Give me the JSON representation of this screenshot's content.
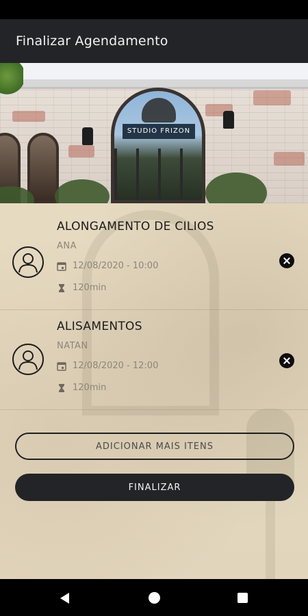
{
  "app_bar": {
    "title": "Finalizar Agendamento"
  },
  "hero": {
    "sign_text": "STUDIO FRIZON"
  },
  "appointments": [
    {
      "service": "ALONGAMENTO DE CILIOS",
      "professional": "ANA",
      "datetime": "12/08/2020 - 10:00",
      "duration": "120min"
    },
    {
      "service": "ALISAMENTOS",
      "professional": "NATAN",
      "datetime": "12/08/2020 - 12:00",
      "duration": "120min"
    }
  ],
  "buttons": {
    "add_more": "ADICIONAR MAIS ITENS",
    "finish": "FINALIZAR"
  },
  "colors": {
    "app_bar": "#232427",
    "background": "#e7dcc4",
    "text_primary": "#1b1b1b",
    "text_secondary": "#8c857a"
  },
  "icons": {
    "avatar": "user-outline-icon",
    "date": "calendar-icon",
    "duration": "hourglass-icon",
    "remove": "close-circle-icon"
  }
}
